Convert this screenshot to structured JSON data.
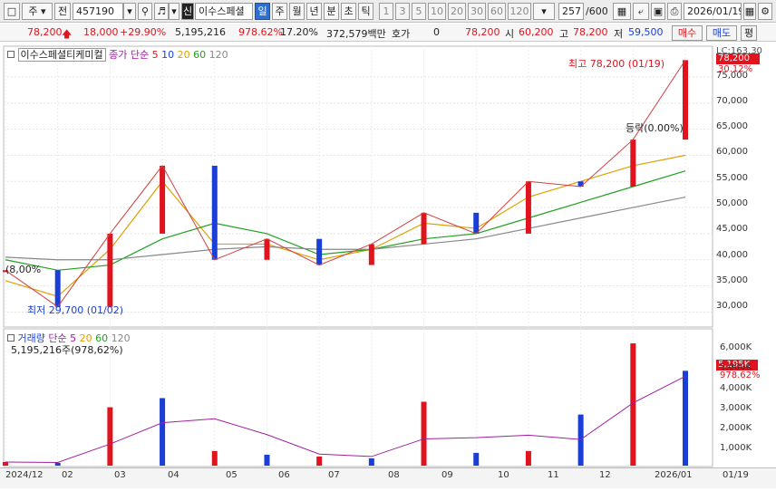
{
  "toolbar": {
    "market": "주",
    "scope": "전",
    "code": "457190",
    "badge": "신",
    "name": "이수스페셜",
    "periods": [
      "일",
      "주",
      "월",
      "년",
      "분",
      "초",
      "틱"
    ],
    "active_period": "일",
    "minutes": [
      "1",
      "3",
      "5",
      "10",
      "20",
      "30",
      "60",
      "120"
    ],
    "count": "257",
    "count_total": "/600",
    "date": "2026/01/19"
  },
  "quote": {
    "price": "78,200",
    "change": "18,000",
    "change_pct": "+29.90%",
    "volume": "5,195,216",
    "vol_ratio": "978.62%",
    "turnover_rate": "17.20%",
    "amount": "372,579백만",
    "hoga_label": "호가",
    "hoga_value": "0",
    "bid": "78,200",
    "open_label": "시",
    "open": "60,200",
    "high_label": "고",
    "high": "78,200",
    "low_label": "저",
    "low": "59,500",
    "buy": "매수",
    "sell": "매도",
    "eval": "평"
  },
  "price_panel": {
    "name_tag": "이수스페셜티케미컬",
    "ma_label": "종가 단순",
    "ma_periods": [
      "5",
      "10",
      "20",
      "60",
      "120"
    ],
    "ma_colors": [
      "#e0141e",
      "#1b3fd6",
      "#e0a000",
      "#22a022",
      "#888888"
    ],
    "max_label": "최고 78,200 (01/19)",
    "min_label": "최저 29,700 (01/02)",
    "drop_label": "등락(0.00%)",
    "left_label": "(8,00%",
    "current_tag": "78,200",
    "current_pct": "30.12%",
    "top_tag": "LC:163.30",
    "yticks": [
      "75,000",
      "70,000",
      "65,000",
      "60,000",
      "55,000",
      "50,000",
      "45,000",
      "40,000",
      "35,000",
      "30,000"
    ]
  },
  "volume_panel": {
    "label": "거래량",
    "ma_label": "단순",
    "ma_periods": [
      "5",
      "20",
      "60",
      "120"
    ],
    "value_text": "5,195,216주(978,62%)",
    "current_tag": "5,195K",
    "current_pct": "978.62%",
    "yticks": [
      "6,000K",
      "5,000K",
      "4,000K",
      "3,000K",
      "2,000K",
      "1,000K"
    ]
  },
  "xaxis": [
    "2024/12",
    "02",
    "03",
    "04",
    "05",
    "06",
    "07",
    "08",
    "09",
    "10",
    "11",
    "12",
    "2026/01",
    "01/19"
  ],
  "chart_data": {
    "type": "line",
    "title": "",
    "ylabel": "",
    "ylim": [
      28000,
      80000
    ],
    "x": [
      "2024/12",
      "2025/01",
      "2025/02",
      "2025/03",
      "2025/04",
      "2025/05",
      "2025/06",
      "2025/07",
      "2025/08",
      "2025/09",
      "2025/10",
      "2025/11",
      "2025/12",
      "2026/01"
    ],
    "series": [
      {
        "name": "종가",
        "values": [
          38000,
          31000,
          45000,
          58000,
          40000,
          44000,
          39000,
          43000,
          49000,
          45000,
          55000,
          54000,
          63000,
          78200
        ]
      },
      {
        "name": "20",
        "values": [
          36000,
          33000,
          42000,
          55000,
          43000,
          43000,
          40000,
          42000,
          47000,
          46000,
          52000,
          55000,
          58000,
          60000
        ]
      },
      {
        "name": "60",
        "values": [
          40000,
          38000,
          39000,
          44000,
          47000,
          45000,
          41000,
          42000,
          44000,
          45000,
          48000,
          51000,
          54000,
          57000
        ]
      },
      {
        "name": "120",
        "values": [
          40500,
          40000,
          40000,
          41000,
          42000,
          42500,
          42000,
          42000,
          43000,
          44000,
          46000,
          48000,
          50000,
          52000
        ]
      }
    ],
    "volume_k": [
      200,
      150,
      3200,
      3700,
      800,
      600,
      500,
      400,
      3500,
      700,
      800,
      2800,
      6700,
      5195
    ]
  }
}
